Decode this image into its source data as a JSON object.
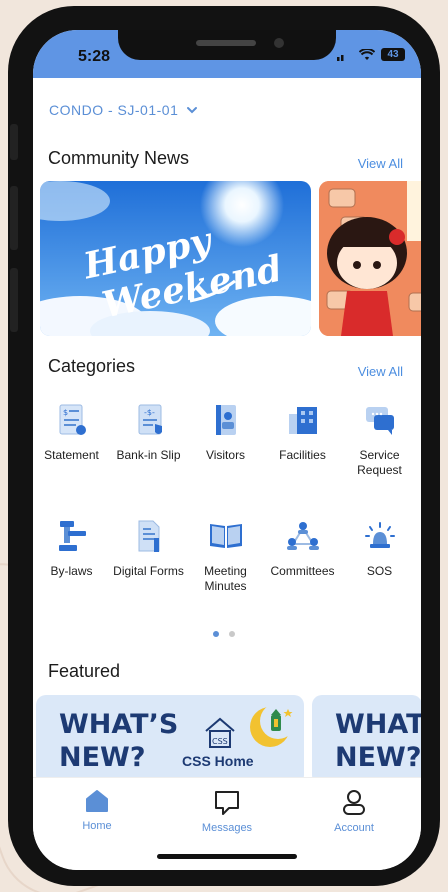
{
  "status": {
    "time": "5:28",
    "battery": "43"
  },
  "unit": {
    "label": "CONDO - SJ-01-01"
  },
  "community_news": {
    "title": "Community News",
    "view_all": "View All",
    "cards": [
      {
        "text_line1": "Happy",
        "text_line2": "Weekend"
      }
    ]
  },
  "categories": {
    "title": "Categories",
    "view_all": "View All",
    "row1": [
      {
        "label": "Statement",
        "icon": "statement-icon"
      },
      {
        "label": "Bank-in Slip",
        "icon": "bank-slip-icon"
      },
      {
        "label": "Visitors",
        "icon": "visitors-icon"
      },
      {
        "label": "Facilities",
        "icon": "facilities-icon"
      },
      {
        "label": "Service Request",
        "icon": "service-request-icon"
      }
    ],
    "row2": [
      {
        "label": "By-laws",
        "icon": "bylaws-icon"
      },
      {
        "label": "Digital Forms",
        "icon": "digital-forms-icon"
      },
      {
        "label": "Meeting Minutes",
        "icon": "meeting-minutes-icon"
      },
      {
        "label": "Committees",
        "icon": "committees-icon"
      },
      {
        "label": "SOS",
        "icon": "sos-icon"
      }
    ]
  },
  "pager": {
    "pages": 2,
    "active": 1
  },
  "featured": {
    "title": "Featured",
    "card1": {
      "headline_1": "WHAT’S",
      "headline_2": "NEW?",
      "brand": "CSS Home",
      "logo_text": "CSS"
    },
    "card2": {
      "headline_1": "WHAT",
      "headline_2": "NEW?"
    }
  },
  "tabs": [
    {
      "label": "Home",
      "icon": "home-icon",
      "active": true
    },
    {
      "label": "Messages",
      "icon": "messages-icon",
      "active": false
    },
    {
      "label": "Account",
      "icon": "account-icon",
      "active": false
    }
  ],
  "colors": {
    "accent": "#5b8fd6",
    "status_bar": "#5f95e4",
    "featured_text": "#1d3a73"
  }
}
